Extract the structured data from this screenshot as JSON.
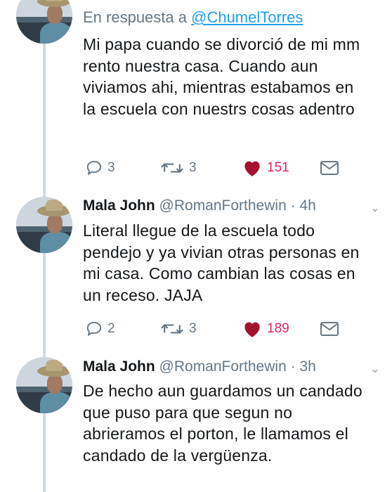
{
  "tweets": [
    {
      "reply_prefix": "En respuesta a",
      "reply_mention": "@ChumelTorres",
      "text": "Mi papa cuando se divorció de mi mm rento nuestra casa. Cuando aun viviamos ahi, mientras estabamos en la escuela con nuestrs cosas adentro",
      "replies": "3",
      "retweets": "3",
      "likes": "151"
    },
    {
      "name": "Mala John",
      "handle": "@RomanForthewin",
      "time": "· 4h",
      "text": "Literal llegue de la escuela todo pendejo y ya vivian otras personas en mi casa. Como cambian las cosas en un receso. JAJA",
      "replies": "2",
      "retweets": "3",
      "likes": "189"
    },
    {
      "name": "Mala John",
      "handle": "@RomanForthewin",
      "time": "· 3h",
      "text": "De hecho aun guardamos un candado que puso para que segun no abrieramos el porton, le llamamos el candado de la vergüenza."
    }
  ],
  "icons": {
    "reply": "speech-bubble-icon",
    "retweet": "retweet-arrows-icon",
    "like": "heart-icon",
    "message": "envelope-icon",
    "menu": "chevron-down-icon"
  },
  "colors": {
    "text": "#14171a",
    "muted": "#657786",
    "link": "#1da1f2",
    "like": "#e0245e",
    "thread_line": "#cfd9de"
  }
}
